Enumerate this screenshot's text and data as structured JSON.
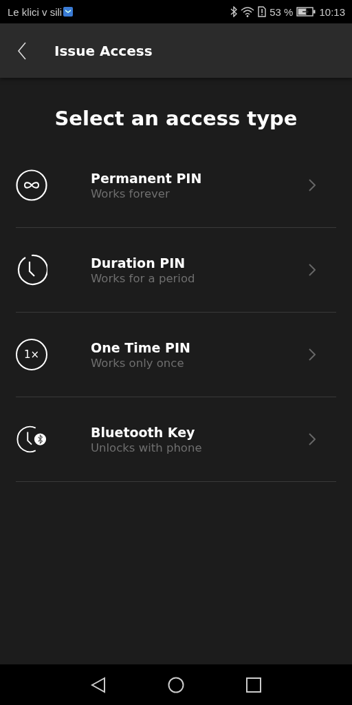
{
  "status_bar": {
    "carrier": "Le klici v sili",
    "battery_percent": "53 %",
    "time": "10:13"
  },
  "app_bar": {
    "title": "Issue Access"
  },
  "heading": "Select an access type",
  "options": [
    {
      "kind": "infinity",
      "title": "Permanent PIN",
      "subtitle": "Works forever"
    },
    {
      "kind": "clock",
      "title": "Duration PIN",
      "subtitle": "Works for a period"
    },
    {
      "kind": "once",
      "icon_text": "1×",
      "title": "One Time PIN",
      "subtitle": "Works only once"
    },
    {
      "kind": "bluetooth",
      "title": "Bluetooth Key",
      "subtitle": "Unlocks with phone"
    }
  ]
}
